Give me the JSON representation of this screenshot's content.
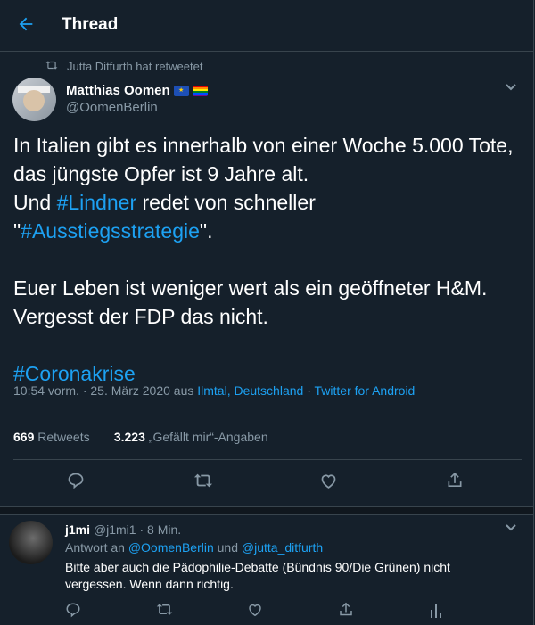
{
  "header": {
    "title": "Thread"
  },
  "retweet_notice": "Jutta Ditfurth hat retweetet",
  "author": {
    "name": "Matthias Oomen",
    "handle": "@OomenBerlin"
  },
  "tweet": {
    "line1": "In Italien gibt es innerhalb von einer Woche 5.000 Tote,",
    "line2": "das jüngste Opfer ist 9 Jahre alt.",
    "line3_pre": "Und ",
    "line3_tag": "#Lindner",
    "line3_post": " redet von schneller",
    "line4_pre": "\"",
    "line4_tag": "#Ausstiegsstrategie",
    "line4_post": "\".",
    "line5": "Euer Leben ist weniger wert als ein geöffneter H&M.",
    "line6": "Vergesst der FDP das nicht.",
    "hashtag": "#Coronakrise"
  },
  "meta": {
    "time": "10:54 vorm.",
    "dot1": " · ",
    "date": "25. März 2020",
    "from": " aus ",
    "location": "Ilmtal, Deutschland",
    "dot2": " · ",
    "source": "Twitter for Android"
  },
  "stats": {
    "retweets_count": "669",
    "retweets_label": " Retweets",
    "likes_count": "3.223",
    "likes_label": " „Gefällt mir“-Angaben"
  },
  "reply": {
    "name": "j1mi",
    "handle_time": " @j1mi1 · 8 Min.",
    "reply_prefix": "Antwort an ",
    "reply_user1": "@OomenBerlin",
    "reply_and": " und ",
    "reply_user2": "@jutta_ditfurth",
    "text_line1": "Bitte aber auch die Pädophilie-Debatte (Bündnis 90/Die Grünen) nicht",
    "text_line2": "vergessen. Wenn dann richtig."
  },
  "colors": {
    "background": "#15202b",
    "accent": "#1da1f2",
    "muted": "#8899a6",
    "border": "#38444d"
  },
  "icons": [
    "back-arrow-icon",
    "retweet-icon",
    "chevron-down-icon",
    "reply-icon",
    "like-icon",
    "share-icon",
    "analytics-icon",
    "eu-flag-icon",
    "rainbow-flag-icon"
  ]
}
